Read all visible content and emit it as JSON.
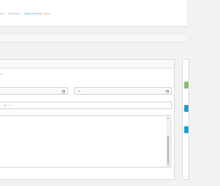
{
  "breadcrumb": {
    "items": [
      "me",
      "Extension",
      "Export Order by"
    ],
    "active_suffix": "Status",
    "separator": "›"
  },
  "filters": {
    "panel_label": "s",
    "date_from_placeholder": "",
    "date_to_placeholder": "To",
    "text_value": "OK I H"
  },
  "colors": {
    "accent_link": "#3a9bd1",
    "accent_sub": "#e6a42e",
    "side_green": "#7cc16a",
    "side_blue": "#1b9ccf"
  },
  "icons": {
    "calendar": "calendar-icon",
    "scroll_up": "caret-up-icon",
    "scroll_down": "caret-down-icon"
  }
}
